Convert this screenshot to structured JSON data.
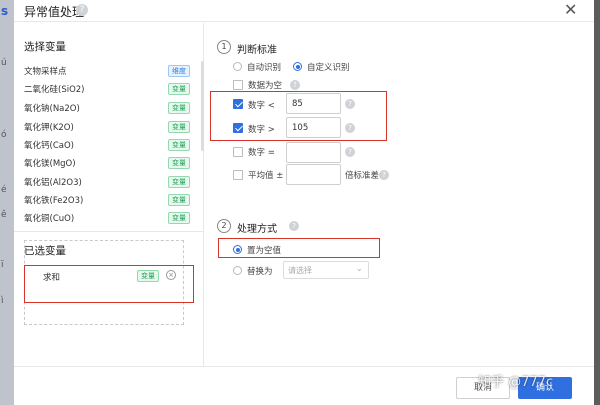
{
  "background": {
    "fragments": [
      "s",
      "ú",
      "ó",
      "é",
      "ê",
      "ï",
      "ì"
    ]
  },
  "dialog": {
    "title": "异常值处理",
    "help_glyph": "?",
    "close_glyph": "✕"
  },
  "left": {
    "choose_title": "选择变量",
    "variables": [
      {
        "name": "文物采样点",
        "tag": "维度"
      },
      {
        "name": "二氧化硅(SiO2)",
        "tag": "变量"
      },
      {
        "name": "氧化钠(Na2O)",
        "tag": "变量"
      },
      {
        "name": "氧化钾(K2O)",
        "tag": "变量"
      },
      {
        "name": "氧化钙(CaO)",
        "tag": "变量"
      },
      {
        "name": "氧化镁(MgO)",
        "tag": "变量"
      },
      {
        "name": "氧化铝(Al2O3)",
        "tag": "变量"
      },
      {
        "name": "氧化铁(Fe2O3)",
        "tag": "变量"
      },
      {
        "name": "氧化铜(CuO)",
        "tag": "变量"
      }
    ],
    "selected_title": "已选变量",
    "selected": {
      "name": "求和",
      "tag": "变量",
      "remove_glyph": "×"
    }
  },
  "right": {
    "step1": {
      "num": "1",
      "title": "判断标准"
    },
    "mode_auto": "自动识别",
    "mode_custom": "自定义识别",
    "empty_label": "数据为空",
    "lt_label": "数字 <",
    "lt_value": "85",
    "gt_label": "数字 >",
    "gt_value": "105",
    "eq_label": "数字 =",
    "mean_label": "平均值 ±",
    "stdev_label": "倍标准差",
    "step2": {
      "num": "2",
      "title": "处理方式"
    },
    "set_null": "置为空值",
    "replace_with": "替换为",
    "select_placeholder": "请选择"
  },
  "footer": {
    "cancel": "取消",
    "ok": "确认",
    "watermark": "知乎 @777c"
  },
  "colors": {
    "accent": "#2f6fe0",
    "highlight": "#d9342b",
    "tag_green": "#22a35b",
    "tag_blue": "#2f7fdb"
  }
}
